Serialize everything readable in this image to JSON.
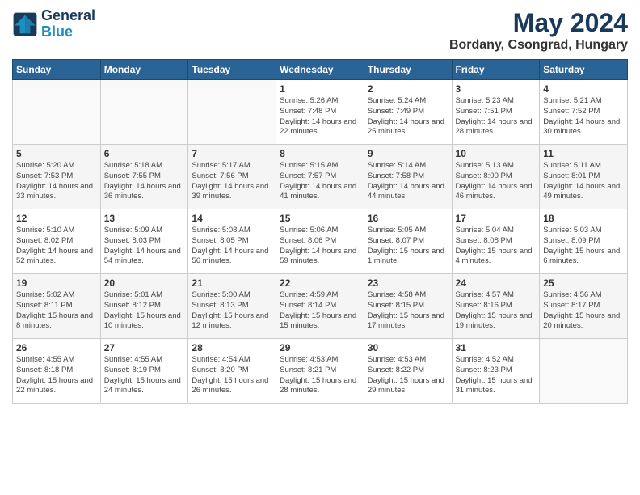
{
  "header": {
    "logo_line1": "General",
    "logo_line2": "Blue",
    "month_year": "May 2024",
    "location": "Bordany, Csongrad, Hungary"
  },
  "days_of_week": [
    "Sunday",
    "Monday",
    "Tuesday",
    "Wednesday",
    "Thursday",
    "Friday",
    "Saturday"
  ],
  "weeks": [
    [
      {
        "day": "",
        "detail": ""
      },
      {
        "day": "",
        "detail": ""
      },
      {
        "day": "",
        "detail": ""
      },
      {
        "day": "1",
        "detail": "Sunrise: 5:26 AM\nSunset: 7:48 PM\nDaylight: 14 hours\nand 22 minutes."
      },
      {
        "day": "2",
        "detail": "Sunrise: 5:24 AM\nSunset: 7:49 PM\nDaylight: 14 hours\nand 25 minutes."
      },
      {
        "day": "3",
        "detail": "Sunrise: 5:23 AM\nSunset: 7:51 PM\nDaylight: 14 hours\nand 28 minutes."
      },
      {
        "day": "4",
        "detail": "Sunrise: 5:21 AM\nSunset: 7:52 PM\nDaylight: 14 hours\nand 30 minutes."
      }
    ],
    [
      {
        "day": "5",
        "detail": "Sunrise: 5:20 AM\nSunset: 7:53 PM\nDaylight: 14 hours\nand 33 minutes."
      },
      {
        "day": "6",
        "detail": "Sunrise: 5:18 AM\nSunset: 7:55 PM\nDaylight: 14 hours\nand 36 minutes."
      },
      {
        "day": "7",
        "detail": "Sunrise: 5:17 AM\nSunset: 7:56 PM\nDaylight: 14 hours\nand 39 minutes."
      },
      {
        "day": "8",
        "detail": "Sunrise: 5:15 AM\nSunset: 7:57 PM\nDaylight: 14 hours\nand 41 minutes."
      },
      {
        "day": "9",
        "detail": "Sunrise: 5:14 AM\nSunset: 7:58 PM\nDaylight: 14 hours\nand 44 minutes."
      },
      {
        "day": "10",
        "detail": "Sunrise: 5:13 AM\nSunset: 8:00 PM\nDaylight: 14 hours\nand 46 minutes."
      },
      {
        "day": "11",
        "detail": "Sunrise: 5:11 AM\nSunset: 8:01 PM\nDaylight: 14 hours\nand 49 minutes."
      }
    ],
    [
      {
        "day": "12",
        "detail": "Sunrise: 5:10 AM\nSunset: 8:02 PM\nDaylight: 14 hours\nand 52 minutes."
      },
      {
        "day": "13",
        "detail": "Sunrise: 5:09 AM\nSunset: 8:03 PM\nDaylight: 14 hours\nand 54 minutes."
      },
      {
        "day": "14",
        "detail": "Sunrise: 5:08 AM\nSunset: 8:05 PM\nDaylight: 14 hours\nand 56 minutes."
      },
      {
        "day": "15",
        "detail": "Sunrise: 5:06 AM\nSunset: 8:06 PM\nDaylight: 14 hours\nand 59 minutes."
      },
      {
        "day": "16",
        "detail": "Sunrise: 5:05 AM\nSunset: 8:07 PM\nDaylight: 15 hours\nand 1 minute."
      },
      {
        "day": "17",
        "detail": "Sunrise: 5:04 AM\nSunset: 8:08 PM\nDaylight: 15 hours\nand 4 minutes."
      },
      {
        "day": "18",
        "detail": "Sunrise: 5:03 AM\nSunset: 8:09 PM\nDaylight: 15 hours\nand 6 minutes."
      }
    ],
    [
      {
        "day": "19",
        "detail": "Sunrise: 5:02 AM\nSunset: 8:11 PM\nDaylight: 15 hours\nand 8 minutes."
      },
      {
        "day": "20",
        "detail": "Sunrise: 5:01 AM\nSunset: 8:12 PM\nDaylight: 15 hours\nand 10 minutes."
      },
      {
        "day": "21",
        "detail": "Sunrise: 5:00 AM\nSunset: 8:13 PM\nDaylight: 15 hours\nand 12 minutes."
      },
      {
        "day": "22",
        "detail": "Sunrise: 4:59 AM\nSunset: 8:14 PM\nDaylight: 15 hours\nand 15 minutes."
      },
      {
        "day": "23",
        "detail": "Sunrise: 4:58 AM\nSunset: 8:15 PM\nDaylight: 15 hours\nand 17 minutes."
      },
      {
        "day": "24",
        "detail": "Sunrise: 4:57 AM\nSunset: 8:16 PM\nDaylight: 15 hours\nand 19 minutes."
      },
      {
        "day": "25",
        "detail": "Sunrise: 4:56 AM\nSunset: 8:17 PM\nDaylight: 15 hours\nand 20 minutes."
      }
    ],
    [
      {
        "day": "26",
        "detail": "Sunrise: 4:55 AM\nSunset: 8:18 PM\nDaylight: 15 hours\nand 22 minutes."
      },
      {
        "day": "27",
        "detail": "Sunrise: 4:55 AM\nSunset: 8:19 PM\nDaylight: 15 hours\nand 24 minutes."
      },
      {
        "day": "28",
        "detail": "Sunrise: 4:54 AM\nSunset: 8:20 PM\nDaylight: 15 hours\nand 26 minutes."
      },
      {
        "day": "29",
        "detail": "Sunrise: 4:53 AM\nSunset: 8:21 PM\nDaylight: 15 hours\nand 28 minutes."
      },
      {
        "day": "30",
        "detail": "Sunrise: 4:53 AM\nSunset: 8:22 PM\nDaylight: 15 hours\nand 29 minutes."
      },
      {
        "day": "31",
        "detail": "Sunrise: 4:52 AM\nSunset: 8:23 PM\nDaylight: 15 hours\nand 31 minutes."
      },
      {
        "day": "",
        "detail": ""
      }
    ]
  ]
}
